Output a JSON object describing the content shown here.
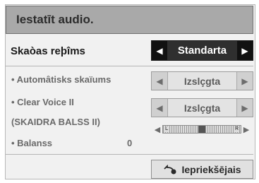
{
  "title": "Iestatīt audio.",
  "sound_mode": {
    "label": "Skaòas reþîms",
    "value": "Standarta",
    "arrow_left": "◀",
    "arrow_right": "▶"
  },
  "auto_volume": {
    "label": "• Automâtisks skaïums",
    "value": "Izslçgta",
    "arrow_left": "◀",
    "arrow_right": "▶"
  },
  "clear_voice": {
    "label_line1": "• Clear Voice II",
    "label_line2": "(SKAIDRA BALSS II)",
    "value": "Izslçgta",
    "arrow_left": "◀",
    "arrow_right": "▶"
  },
  "balance": {
    "label": "• Balanss",
    "value": "0",
    "left_marker": "L",
    "right_marker": "R",
    "level_fraction": 0.5,
    "arrow_left": "◀",
    "arrow_right": "▶"
  },
  "back_button": {
    "icon": "back-arrow-icon",
    "label": "Iepriekšējais"
  }
}
